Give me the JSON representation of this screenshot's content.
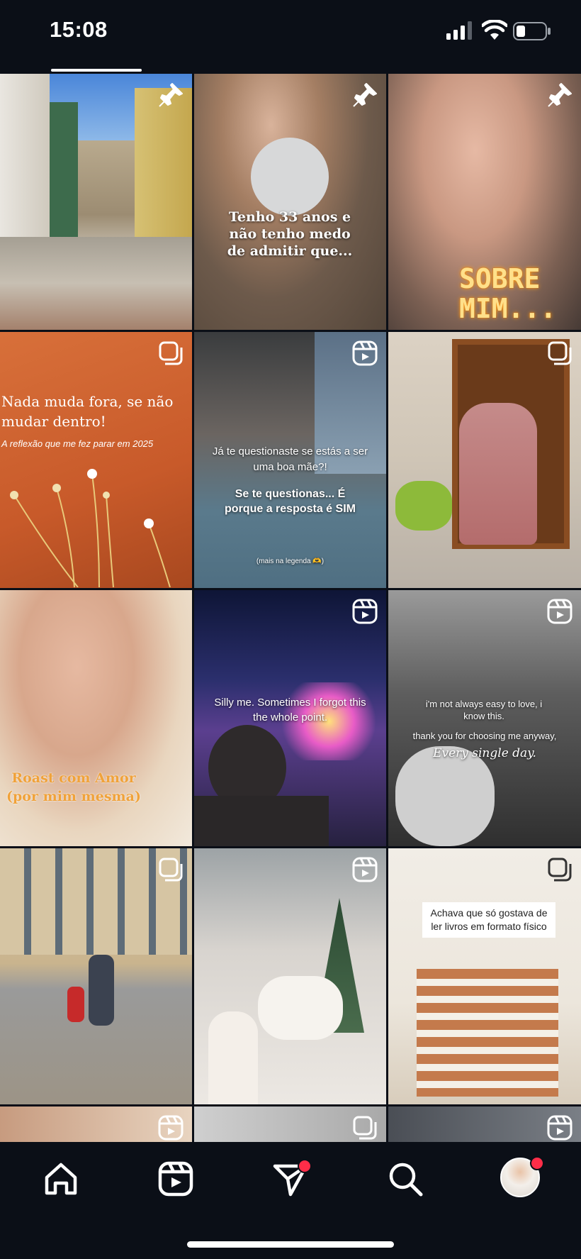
{
  "status_bar": {
    "time": "15:08"
  },
  "grid": {
    "tiles": [
      {
        "badge": "pin-icon",
        "caption": ""
      },
      {
        "badge": "pin-icon",
        "caption": "Tenho 33 anos e não tenho medo de admitir que..."
      },
      {
        "badge": "pin-icon",
        "caption": "SOBRE MIM..."
      },
      {
        "badge": "carousel-icon",
        "caption": "Nada muda fora, se não mudar dentro!",
        "subcaption": "A reflexão que me fez parar em 2025"
      },
      {
        "badge": "reel-icon",
        "caption": "Já te questionaste se estás a ser uma boa mãe?!",
        "caption2": "Se te questionas... É porque a resposta é SIM",
        "footnote": "(mais na legenda 🫶)"
      },
      {
        "badge": "carousel-icon",
        "caption": ""
      },
      {
        "badge": "",
        "caption": "Roast com Amor (por mim mesma)"
      },
      {
        "badge": "reel-icon",
        "caption": "Silly me. Sometimes I forgot this the whole point."
      },
      {
        "badge": "reel-icon",
        "caption": "i'm not always easy to love, i know this.",
        "caption2": "thank you for choosing me anyway,",
        "caption3": "Every single day."
      },
      {
        "badge": "carousel-icon",
        "caption": ""
      },
      {
        "badge": "reel-icon",
        "caption": ""
      },
      {
        "badge": "carousel-icon",
        "caption": "Achava que só gostava de ler livros em formato físico"
      },
      {
        "badge": "reel-icon",
        "caption": ""
      },
      {
        "badge": "carousel-icon",
        "caption": ""
      },
      {
        "badge": "reel-icon",
        "caption": ""
      }
    ]
  },
  "bottom_nav": {
    "items": [
      "home-icon",
      "reels-icon",
      "direct-messages-icon",
      "search-icon",
      "profile-avatar"
    ],
    "notification_color": "#ff2d48"
  }
}
